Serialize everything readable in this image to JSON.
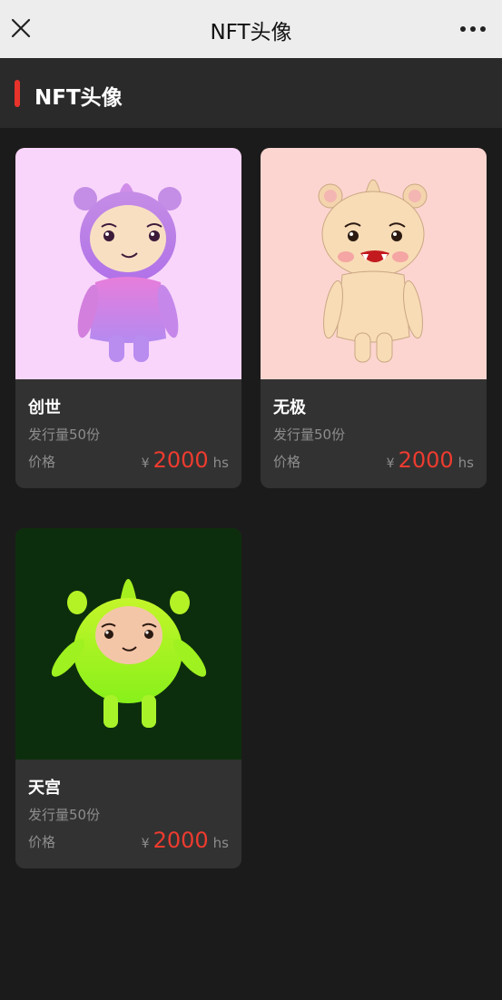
{
  "header": {
    "title": "NFT头像",
    "close_icon": "close-icon",
    "more_icon": "more-icon"
  },
  "section": {
    "title": "NFT头像",
    "accent": "#e8332a"
  },
  "cards": [
    {
      "name": "创世",
      "supply": "发行量50份",
      "price_label": "价格",
      "currency": "¥",
      "price": "2000",
      "unit": "hs",
      "bg": "#f9d5fb"
    },
    {
      "name": "无极",
      "supply": "发行量50份",
      "price_label": "价格",
      "currency": "¥",
      "price": "2000",
      "unit": "hs",
      "bg": "#fdd5d0"
    },
    {
      "name": "天宫",
      "supply": "发行量50份",
      "price_label": "价格",
      "currency": "¥",
      "price": "2000",
      "unit": "hs",
      "bg": "#0d2e0d"
    }
  ]
}
